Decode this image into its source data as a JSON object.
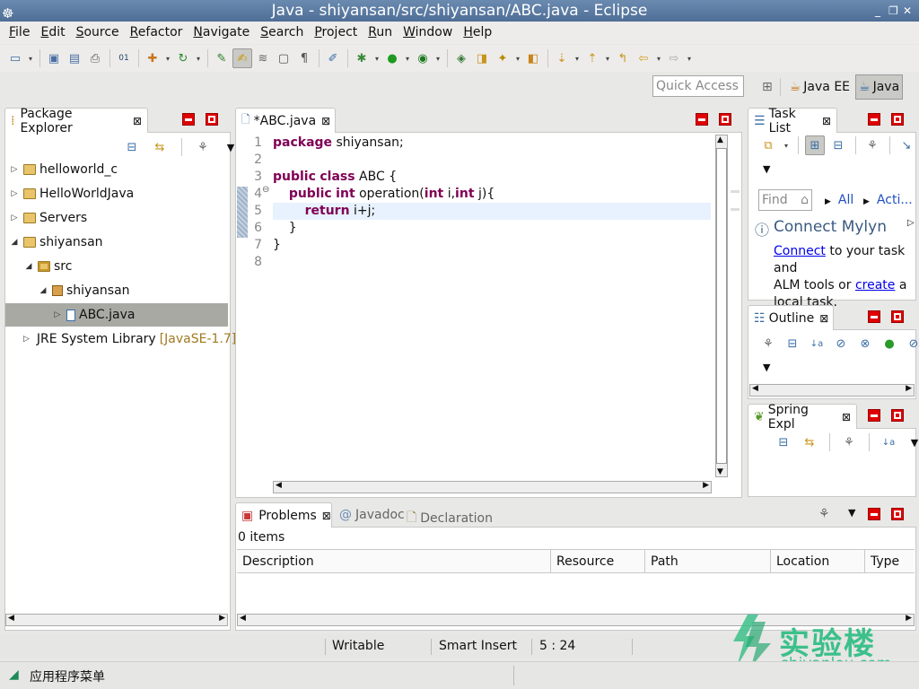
{
  "window": {
    "title": "Java - shiyansan/src/shiyansan/ABC.java - Eclipse",
    "minimize": "_",
    "restore": "❐",
    "close": "✕"
  },
  "menu": [
    "File",
    "Edit",
    "Source",
    "Refactor",
    "Navigate",
    "Search",
    "Project",
    "Run",
    "Window",
    "Help"
  ],
  "quick_access": {
    "placeholder": "Quick Access"
  },
  "perspectives": [
    {
      "label": "Java EE",
      "active": false
    },
    {
      "label": "Java",
      "active": true
    }
  ],
  "package_explorer": {
    "tab": "Package Explorer",
    "items": [
      {
        "label": "helloworld_c",
        "level": 0,
        "expanded": false,
        "icon": "project-icon"
      },
      {
        "label": "HelloWorldJava",
        "level": 0,
        "expanded": false,
        "icon": "project-icon"
      },
      {
        "label": "Servers",
        "level": 0,
        "expanded": false,
        "icon": "folder-icon"
      },
      {
        "label": "shiyansan",
        "level": 0,
        "expanded": true,
        "icon": "project-icon"
      },
      {
        "label": "src",
        "level": 1,
        "expanded": true,
        "icon": "source-folder-icon"
      },
      {
        "label": "shiyansan",
        "level": 2,
        "expanded": true,
        "icon": "package-icon"
      },
      {
        "label": "ABC.java",
        "level": 3,
        "expanded": false,
        "icon": "java-file-icon",
        "selected": true
      },
      {
        "label": "JRE System Library",
        "suffix": "[JavaSE-1.7]",
        "level": 1,
        "expanded": false,
        "icon": "library-icon"
      }
    ]
  },
  "editor": {
    "tab": "*ABC.java",
    "line_numbers": [
      "1",
      "2",
      "3",
      "4",
      "5",
      "6",
      "7",
      "8"
    ],
    "lines": [
      [
        {
          "t": "package",
          "kw": true
        },
        {
          "t": " shiyansan;"
        }
      ],
      [],
      [
        {
          "t": "public",
          "kw": true
        },
        {
          "t": " "
        },
        {
          "t": "class",
          "kw": true
        },
        {
          "t": " ABC {"
        }
      ],
      [
        {
          "t": "    "
        },
        {
          "t": "public",
          "kw": true
        },
        {
          "t": " "
        },
        {
          "t": "int",
          "kw": true
        },
        {
          "t": " operation("
        },
        {
          "t": "int",
          "kw": true
        },
        {
          "t": " i,"
        },
        {
          "t": "int",
          "kw": true
        },
        {
          "t": " j){"
        }
      ],
      [
        {
          "t": "        "
        },
        {
          "t": "return",
          "kw": true
        },
        {
          "t": " i+j;"
        }
      ],
      [
        {
          "t": "    }"
        }
      ],
      [
        {
          "t": "}"
        }
      ],
      []
    ]
  },
  "task_list": {
    "tab": "Task List",
    "find_placeholder": "Find",
    "all": "All",
    "activate": "Acti...",
    "mylyn_title": "Connect Mylyn",
    "mylyn_connect": "Connect",
    "mylyn_text1": " to your task and",
    "mylyn_text2": "ALM tools or ",
    "mylyn_create": "create",
    "mylyn_text3": " a",
    "mylyn_text4": "local task."
  },
  "outline": {
    "tab": "Outline"
  },
  "spring": {
    "tab": "Spring Expl"
  },
  "problems": {
    "tabs": [
      {
        "label": "Problems",
        "active": true
      },
      {
        "label": "Javadoc",
        "active": false
      },
      {
        "label": "Declaration",
        "active": false
      }
    ],
    "count": "0 items",
    "columns": [
      "Description",
      "Resource",
      "Path",
      "Location",
      "Type"
    ]
  },
  "status": {
    "writable": "Writable",
    "insert": "Smart Insert",
    "position": "5 : 24"
  },
  "taskbar": {
    "menu": "应用程序菜单"
  },
  "watermark": {
    "cn": "实验楼",
    "en": "shiyanlou.com"
  },
  "colors": {
    "keyword": "#7f0055",
    "selection": "#a9a9a4",
    "title_bg": "#5a7aa2",
    "close_red": "#e00000"
  }
}
